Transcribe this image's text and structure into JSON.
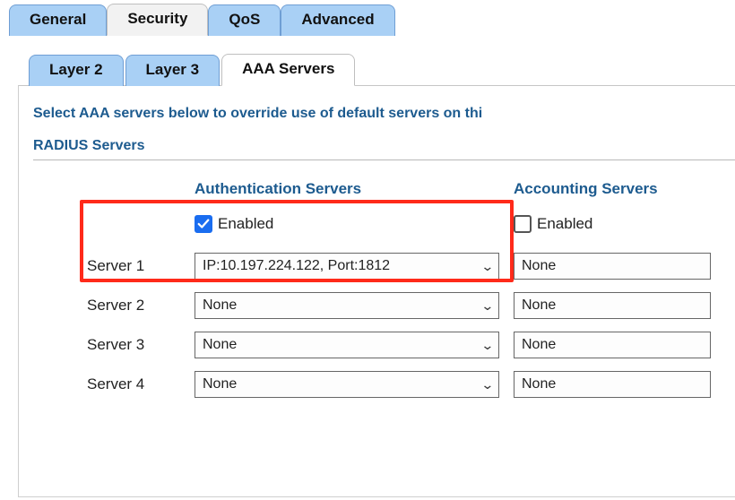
{
  "top_tabs": {
    "general": "General",
    "security": "Security",
    "qos": "QoS",
    "advanced": "Advanced",
    "active": "security"
  },
  "sub_tabs": {
    "layer2": "Layer 2",
    "layer3": "Layer 3",
    "aaa": "AAA Servers",
    "active": "aaa"
  },
  "instruction": "Select AAA servers below to override use of default servers on thi",
  "radius_heading": "RADIUS Servers",
  "columns": {
    "auth_header": "Authentication Servers",
    "acct_header": "Accounting Servers"
  },
  "auth": {
    "enabled_label": "Enabled",
    "enabled_checked": true,
    "servers": [
      {
        "label": "Server 1",
        "value": "IP:10.197.224.122, Port:1812"
      },
      {
        "label": "Server 2",
        "value": "None"
      },
      {
        "label": "Server 3",
        "value": "None"
      },
      {
        "label": "Server 4",
        "value": "None"
      }
    ]
  },
  "acct": {
    "enabled_label": "Enabled",
    "enabled_checked": false,
    "servers": [
      {
        "value": "None"
      },
      {
        "value": "None"
      },
      {
        "value": "None"
      },
      {
        "value": "None"
      }
    ]
  }
}
